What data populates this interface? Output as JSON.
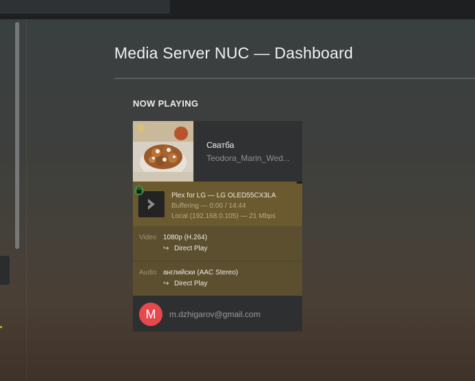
{
  "page": {
    "title": "Media Server NUC — Dashboard"
  },
  "now_playing": {
    "heading": "NOW PLAYING",
    "media": {
      "title": "Сватба",
      "subtitle": "Teodora_Marin_Wed...",
      "progress_fraction": 0.0
    },
    "player": {
      "device_line": "Plex for LG  —  LG OLED55CX3LA",
      "status_line": "Buffering — 0:00 / 14:44",
      "network_line": "Local (192.168.0.105) — 21 Mbps",
      "secure": true
    },
    "video": {
      "label": "Video",
      "value": "1080p (H.264)",
      "arrow": "↪",
      "mode": "Direct Play"
    },
    "audio": {
      "label": "Audio",
      "value": "английски (AAC Stereo)",
      "arrow": "↪",
      "mode": "Direct Play"
    },
    "user": {
      "avatar_letter": "M",
      "email": "m.dzhigarov@gmail.com",
      "avatar_color": "#e5484d"
    }
  },
  "icons": {
    "lock": "lock-icon",
    "device": "chevron-right-icon"
  },
  "colors": {
    "player_row": "#6b5a2f",
    "stream_row": "#5b4f30",
    "secure_badge": "#3b8a3e"
  }
}
